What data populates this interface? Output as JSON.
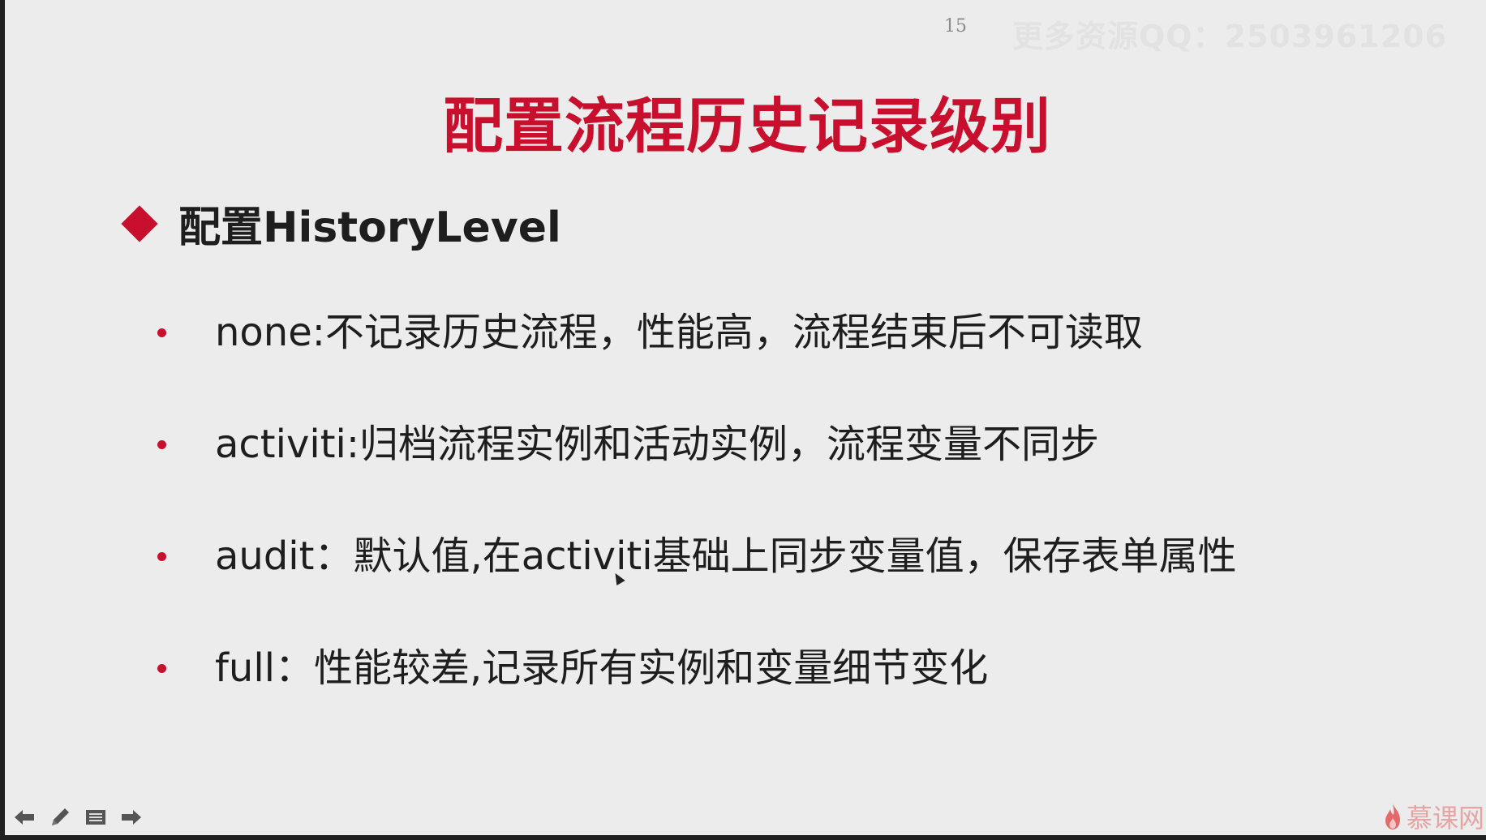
{
  "slide": {
    "page_number": "15",
    "watermark": "更多资源QQ：2503961206",
    "title": "配置流程历史记录级别",
    "section_heading": "配置HistoryLevel",
    "bullets": [
      {
        "text": "none:不记录历史流程，性能高，流程结束后不可读取"
      },
      {
        "text": "activiti:归档流程实例和活动实例，流程变量不同步"
      },
      {
        "text": "audit：默认值,在activiti基础上同步变量值，保存表单属性"
      },
      {
        "text": "full：性能较差,记录所有实例和变量细节变化"
      }
    ]
  },
  "toolbar": {
    "buttons": [
      {
        "icon": "arrow-left-icon"
      },
      {
        "icon": "pen-icon"
      },
      {
        "icon": "menu-icon"
      },
      {
        "icon": "arrow-right-icon"
      }
    ]
  },
  "brand": {
    "name": "慕课网",
    "icon": "flame-icon"
  },
  "colors": {
    "accent": "#c8102e",
    "background": "#ececec",
    "text": "#1e1e1e"
  }
}
